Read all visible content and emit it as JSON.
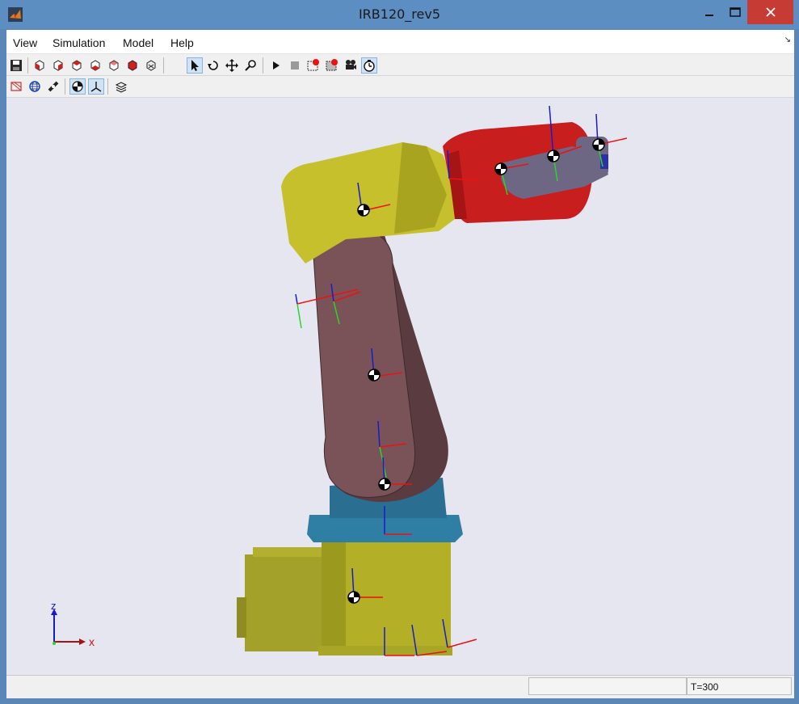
{
  "window": {
    "title": "IRB120_rev5"
  },
  "menu": {
    "items": [
      "View",
      "Simulation",
      "Model",
      "Help"
    ]
  },
  "toolbar1": {
    "icons": [
      "save-icon",
      "view-front-icon",
      "view-back-icon",
      "view-left-icon",
      "view-right-icon",
      "view-top-icon",
      "view-bottom-icon",
      "view-iso-icon",
      "select-icon",
      "rotate-icon",
      "pan-icon",
      "zoom-icon",
      "play-icon",
      "stop-icon",
      "record-icon",
      "record-region-icon",
      "camera-icon",
      "timer-icon"
    ]
  },
  "toolbar2": {
    "icons": [
      "wireframe-icon",
      "globe-icon",
      "convert-icon",
      "center-of-mass-icon",
      "frames-icon",
      "layers-icon"
    ]
  },
  "axes_triad": {
    "z_label": "z",
    "x_label": "x"
  },
  "status": {
    "left": "",
    "time": "T=300"
  },
  "colors": {
    "base_yellow": "#b3b327",
    "link_blue": "#2f7ea3",
    "arm_brown": "#7a5358",
    "shoulder_yellow": "#c5c02b",
    "wrist_red": "#c81e1e",
    "tool_gray": "#6e6784"
  }
}
